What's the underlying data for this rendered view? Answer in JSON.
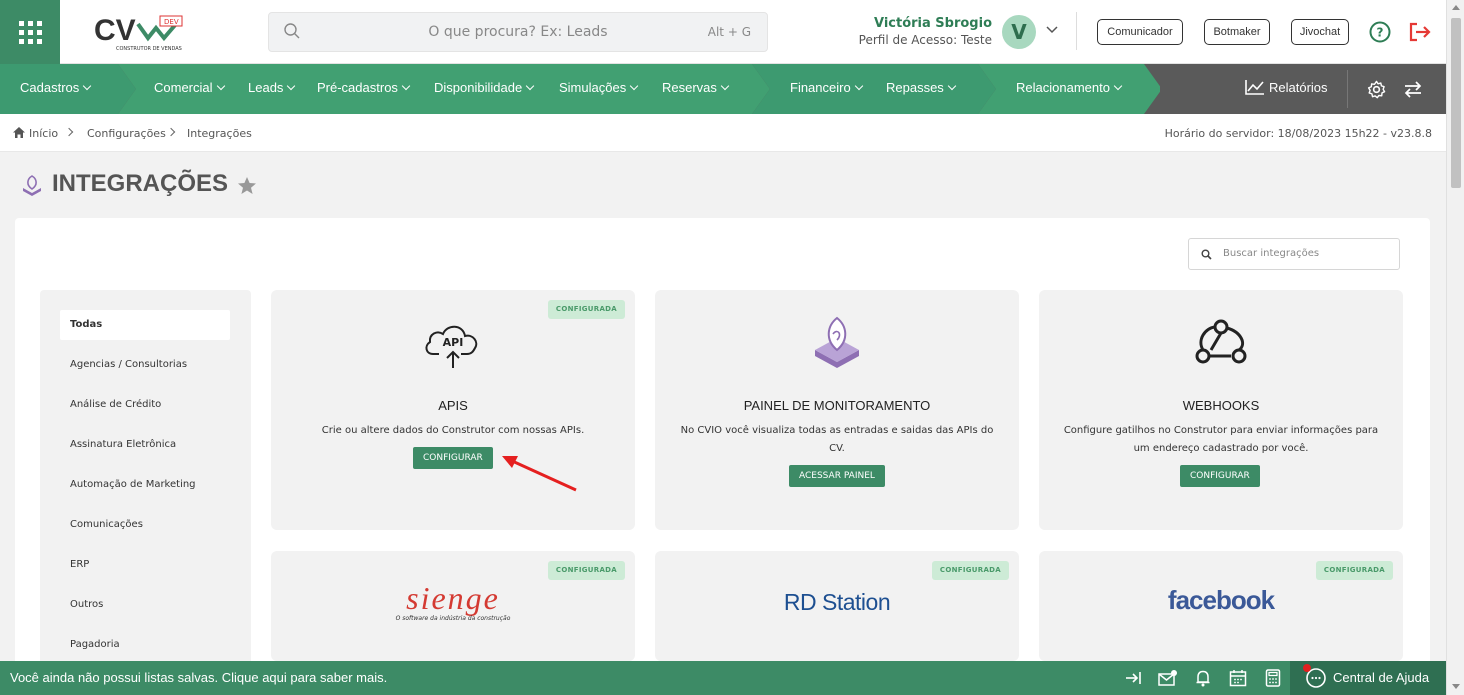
{
  "header": {
    "logo_text": "CV",
    "logo_badge": "DEV",
    "logo_sub": "CONSTRUTOR DE VENDAS",
    "search_placeholder": "O que procura? Ex: Leads",
    "search_shortcut": "Alt + G",
    "user_name": "Victória Sbrogio",
    "user_profile": "Perfil de Acesso: Teste",
    "avatar_letter": "V",
    "buttons": [
      "Comunicador",
      "Botmaker",
      "Jivochat"
    ]
  },
  "nav": {
    "items": [
      "Cadastros",
      "Comercial",
      "Leads",
      "Pré-cadastros",
      "Disponibilidade",
      "Simulações",
      "Reservas",
      "Financeiro",
      "Repasses",
      "Relacionamento"
    ],
    "reports": "Relatórios"
  },
  "breadcrumb": {
    "items": [
      "Início",
      "Configurações",
      "Integrações"
    ],
    "server_time": "Horário do servidor: 18/08/2023 15h22 - v23.8.8"
  },
  "page": {
    "title": "INTEGRAÇÕES",
    "search_placeholder": "Buscar integrações"
  },
  "sidebar": {
    "items": [
      "Todas",
      "Agencias / Consultorias",
      "Análise de Crédito",
      "Assinatura Eletrônica",
      "Automação de Marketing",
      "Comunicações",
      "ERP",
      "Outros",
      "Pagadoria"
    ]
  },
  "cards": [
    {
      "title": "APIS",
      "desc": "Crie ou altere dados do Construtor com nossas APIs.",
      "button": "CONFIGURAR",
      "badge": "CONFIGURADA",
      "icon_text": "API"
    },
    {
      "title": "PAINEL DE MONITORAMENTO",
      "desc": "No CVIO você visualiza todas as entradas e saidas das APIs do CV.",
      "button": "ACESSAR PAINEL"
    },
    {
      "title": "WEBHOOKS",
      "desc": "Configure gatilhos no Construtor para enviar informações para um endereço cadastrado por você.",
      "button": "CONFIGURAR"
    },
    {
      "badge": "CONFIGURADA",
      "logo": "sienge",
      "logo_sub": "O software da indústria da construção"
    },
    {
      "badge": "CONFIGURADA",
      "logo": "RD Station"
    },
    {
      "badge": "CONFIGURADA",
      "logo": "facebook"
    }
  ],
  "bottom": {
    "message": "Você ainda não possui listas salvas. Clique aqui para saber mais.",
    "help": "Central de Ajuda"
  },
  "colors": {
    "brand_green": "#3d8b66",
    "nav_green": "#3d9a70",
    "nav_gray": "#5a5a5a",
    "logout_red": "#e53935"
  }
}
